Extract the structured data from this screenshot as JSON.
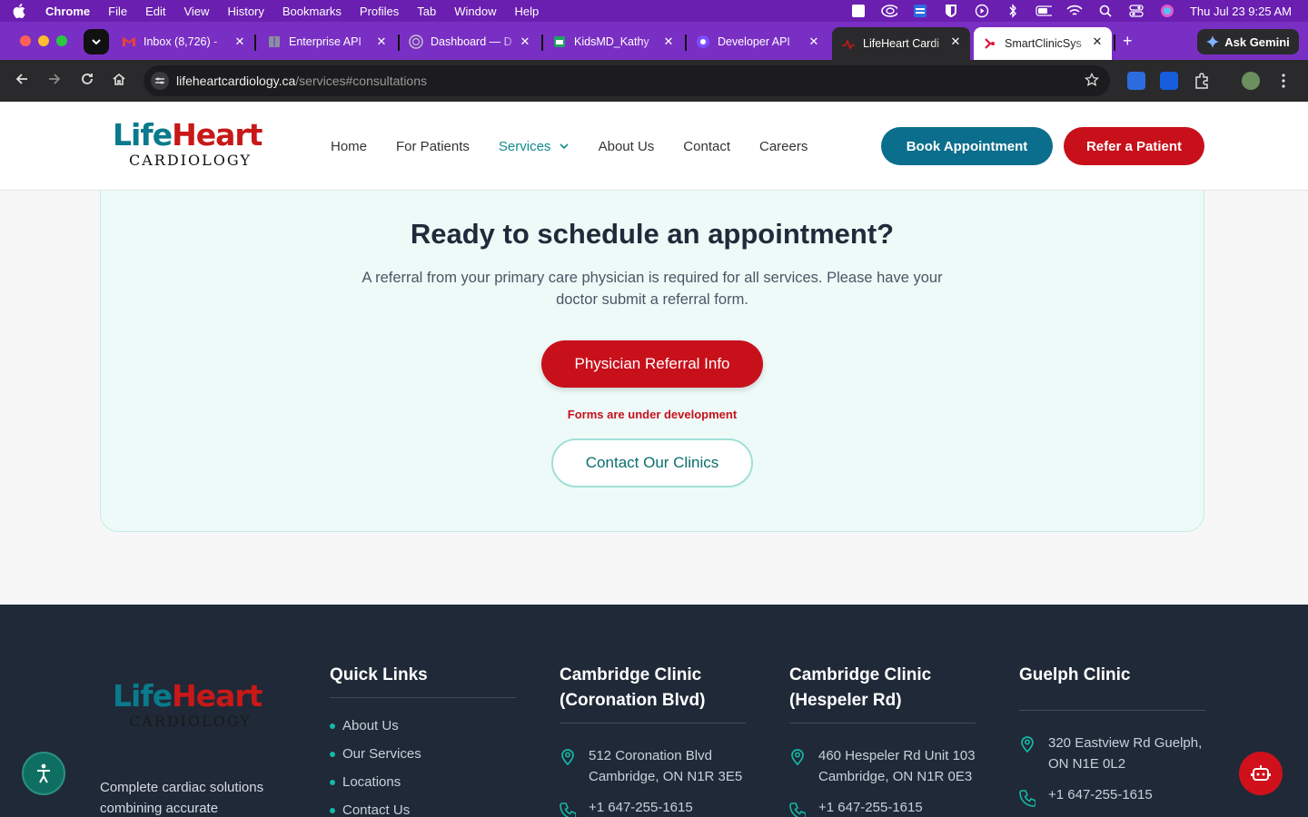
{
  "menubar": {
    "app_name": "Chrome",
    "items": [
      "File",
      "Edit",
      "View",
      "History",
      "Bookmarks",
      "Profiles",
      "Tab",
      "Window",
      "Help"
    ],
    "clock": "Thu Jul 23  9:25 AM"
  },
  "tabs": [
    {
      "label": "Inbox (8,726) -",
      "icon": "gmail-icon",
      "color": "#ea4335"
    },
    {
      "label": "Enterprise API",
      "icon": "book-icon",
      "color": "#8a8fa0"
    },
    {
      "label": "Dashboard — D",
      "icon": "globe-icon",
      "color": "#9aa0a6"
    },
    {
      "label": "KidsMD_Kathy",
      "icon": "sheets-icon",
      "color": "#1fa463"
    },
    {
      "label": "Developer API",
      "icon": "dev-icon",
      "color": "#7c4dff"
    },
    {
      "label": "LifeHeart Cardi",
      "icon": "lifeheart-icon",
      "color": "#c81818"
    },
    {
      "label": "SmartClinicSys",
      "icon": "smartclinic-icon",
      "color": "#e0103a"
    }
  ],
  "gemini_label": "Ask Gemini",
  "address_bar": {
    "domain": "lifeheartcardiology.ca",
    "path": "/services#consultations"
  },
  "site": {
    "logo": {
      "life": "Life",
      "heart": "Heart",
      "sub": "CARDIOLOGY"
    },
    "nav": [
      "Home",
      "For Patients",
      "Services",
      "About Us",
      "Contact",
      "Careers"
    ],
    "book_label": "Book Appointment",
    "refer_label": "Refer a Patient"
  },
  "cta": {
    "title": "Ready to schedule an appointment?",
    "text": "A referral from your primary care physician is required for all services. Please have your doctor submit a referral form.",
    "physician_label": "Physician Referral Info",
    "dev_note": "Forms are under development",
    "contact_label": "Contact Our Clinics"
  },
  "footer": {
    "tagline": "Complete cardiac solutions combining accurate",
    "quick_links_title": "Quick Links",
    "quick_links": [
      "About Us",
      "Our Services",
      "Locations",
      "Contact Us"
    ],
    "clinics": [
      {
        "name": "Cambridge Clinic (Coronation Blvd)",
        "address": "512 Coronation Blvd Cambridge, ON N1R 3E5",
        "phone": "+1 647-255-1615"
      },
      {
        "name": "Cambridge Clinic (Hespeler Rd)",
        "address": "460 Hespeler Rd Unit 103 Cambridge, ON N1R 0E3",
        "phone": "+1 647-255-1615"
      },
      {
        "name": "Guelph Clinic",
        "address": "320 Eastview Rd Guelph, ON N1E 0L2",
        "phone": "+1 647-255-1615"
      }
    ]
  },
  "colors": {
    "teal": "#0b6e8c",
    "red": "#c8101b",
    "footer_bg": "#1f2937",
    "accent_teal": "#17b8a6"
  }
}
